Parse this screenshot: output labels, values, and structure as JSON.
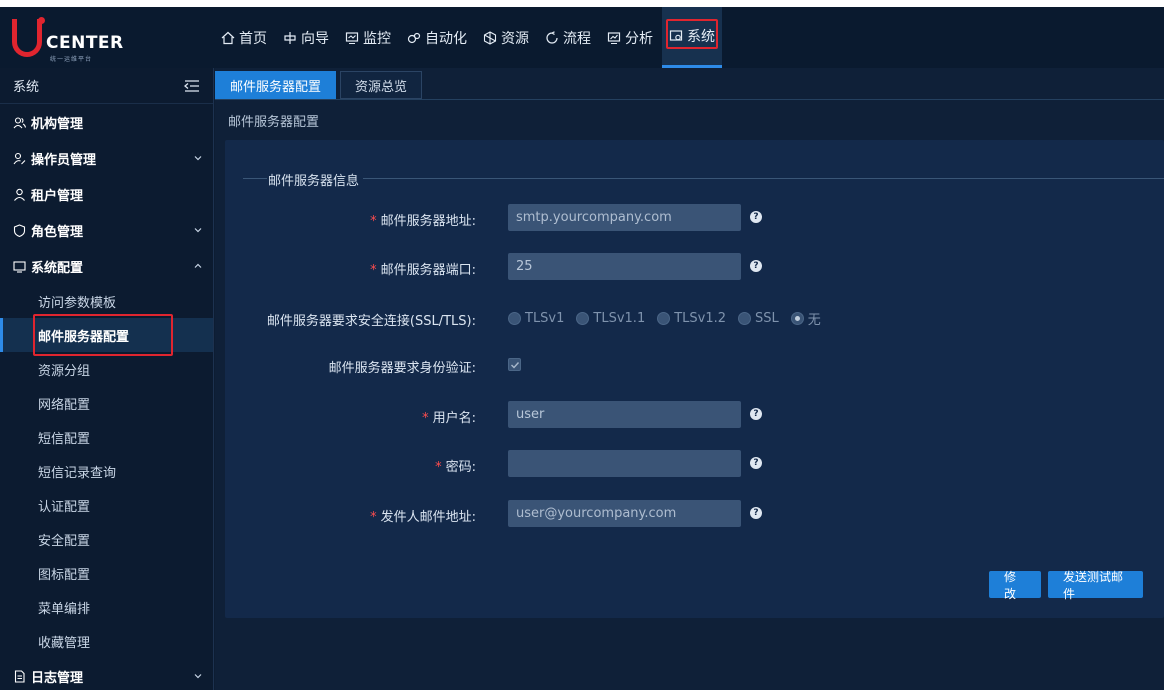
{
  "brand": {
    "name": "CENTER",
    "sub": "统一运维平台"
  },
  "nav": [
    {
      "label": "首页",
      "icon": "home-icon"
    },
    {
      "label": "向导",
      "icon": "guide-icon"
    },
    {
      "label": "监控",
      "icon": "monitor-icon"
    },
    {
      "label": "自动化",
      "icon": "automation-icon"
    },
    {
      "label": "资源",
      "icon": "resource-icon"
    },
    {
      "label": "流程",
      "icon": "flow-icon"
    },
    {
      "label": "分析",
      "icon": "analysis-icon"
    },
    {
      "label": "系统",
      "icon": "system-icon",
      "active": true
    }
  ],
  "sidebar": {
    "title": "系统",
    "groups": [
      {
        "label": "机构管理"
      },
      {
        "label": "操作员管理"
      },
      {
        "label": "租户管理"
      },
      {
        "label": "角色管理"
      },
      {
        "label": "系统配置"
      }
    ],
    "items": [
      "访问参数模板",
      "邮件服务器配置",
      "资源分组",
      "网络配置",
      "短信配置",
      "短信记录查询",
      "认证配置",
      "安全配置",
      "图标配置",
      "菜单编排",
      "收藏管理"
    ],
    "last_group": "日志管理"
  },
  "tabs": [
    "邮件服务器配置",
    "资源总览"
  ],
  "breadcrumb": "邮件服务器配置",
  "form": {
    "legend": "邮件服务器信息",
    "host_label": "邮件服务器地址:",
    "host_placeholder": "smtp.yourcompany.com",
    "port_label": "邮件服务器端口:",
    "port_value": "25",
    "ssl_label": "邮件服务器要求安全连接(SSL/TLS):",
    "ssl_options": [
      "TLSv1",
      "TLSv1.1",
      "TLSv1.2",
      "SSL",
      "无"
    ],
    "ssl_selected": "无",
    "auth_label": "邮件服务器要求身份验证:",
    "user_label": "用户名:",
    "user_value": "user",
    "pwd_label": "密码:",
    "pwd_value": "",
    "sender_label": "发件人邮件地址:",
    "sender_placeholder": "user@yourcompany.com",
    "required_mark": "*",
    "help_mark": "?"
  },
  "buttons": {
    "modify": "修改",
    "test": "发送测试邮件"
  },
  "colors": {
    "accent": "#1e7fd8",
    "highlight": "#e0252f",
    "required": "#ff4d4f"
  }
}
